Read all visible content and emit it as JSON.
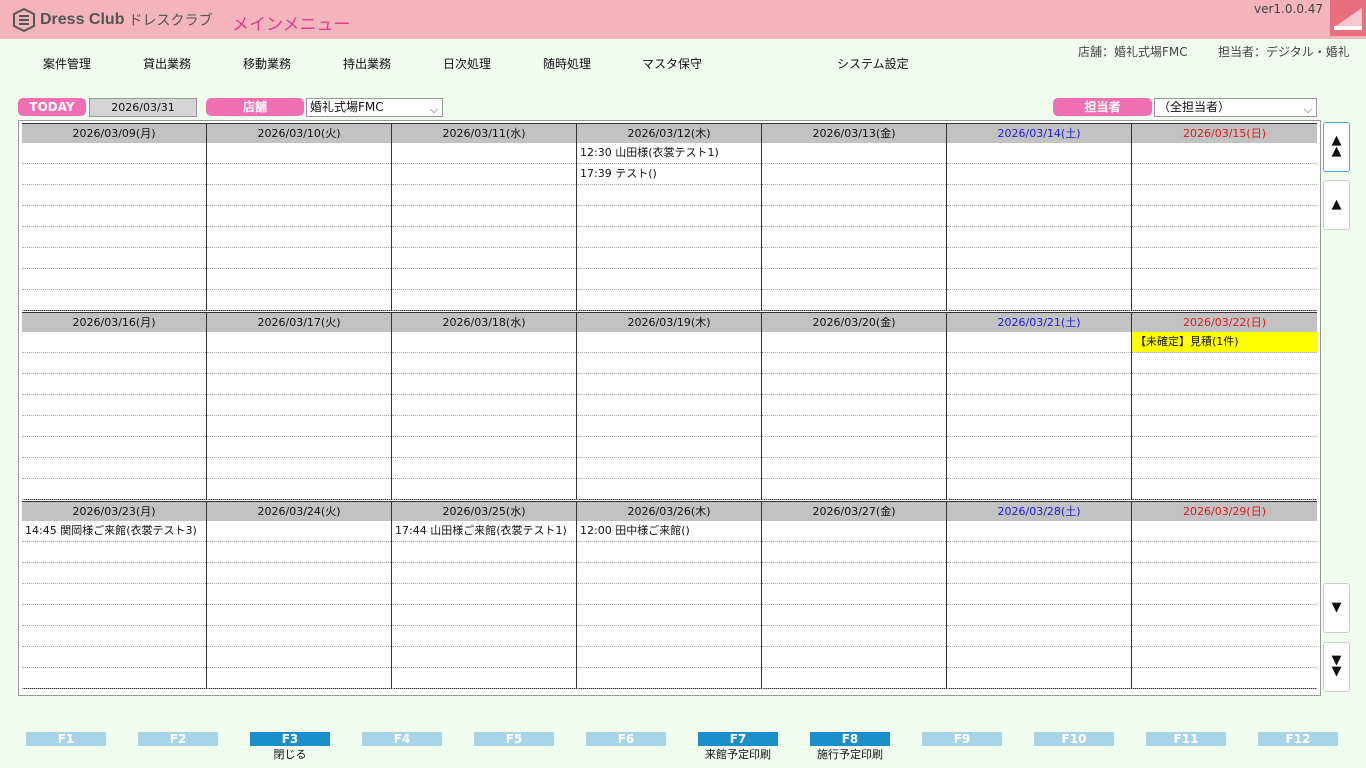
{
  "app": {
    "logo_text": "Dress Club",
    "logo_kana": "ドレスクラブ",
    "title": "メインメニュー",
    "version": "ver1.0.0.47"
  },
  "menu": [
    "案件管理",
    "貸出業務",
    "移動業務",
    "持出業務",
    "日次処理",
    "随時処理",
    "マスタ保守",
    "システム設定"
  ],
  "info": {
    "store": "店舗：婚礼式場FMC",
    "staff": "担当者：デジタル・婚礼"
  },
  "toolbar": {
    "today_label": "TODAY",
    "today_date": "2026/03/31",
    "store_label": "店舗",
    "store_value": "婚礼式場FMC",
    "staff_label": "担当者",
    "staff_value": "（全担当者）"
  },
  "weeks": [
    {
      "days": [
        {
          "date": "2026/03/09(月)",
          "type": "weekday",
          "events": []
        },
        {
          "date": "2026/03/10(火)",
          "type": "weekday",
          "events": []
        },
        {
          "date": "2026/03/11(水)",
          "type": "weekday",
          "events": []
        },
        {
          "date": "2026/03/12(木)",
          "type": "weekday",
          "events": [
            "12:30 山田様(衣裳テスト1)",
            "17:39 テスト()"
          ]
        },
        {
          "date": "2026/03/13(金)",
          "type": "weekday",
          "events": []
        },
        {
          "date": "2026/03/14(土)",
          "type": "sat",
          "events": []
        },
        {
          "date": "2026/03/15(日)",
          "type": "sun",
          "events": []
        }
      ]
    },
    {
      "days": [
        {
          "date": "2026/03/16(月)",
          "type": "weekday",
          "events": []
        },
        {
          "date": "2026/03/17(火)",
          "type": "weekday",
          "events": []
        },
        {
          "date": "2026/03/18(水)",
          "type": "weekday",
          "events": []
        },
        {
          "date": "2026/03/19(木)",
          "type": "weekday",
          "events": []
        },
        {
          "date": "2026/03/20(金)",
          "type": "weekday",
          "events": []
        },
        {
          "date": "2026/03/21(土)",
          "type": "sat",
          "events": []
        },
        {
          "date": "2026/03/22(日)",
          "type": "sun",
          "events": [
            "【未確定】見積(1件)"
          ],
          "highlight": true
        }
      ]
    },
    {
      "days": [
        {
          "date": "2026/03/23(月)",
          "type": "weekday",
          "events": [
            "14:45 関岡様ご来館(衣裳テスト3)"
          ]
        },
        {
          "date": "2026/03/24(火)",
          "type": "weekday",
          "events": []
        },
        {
          "date": "2026/03/25(水)",
          "type": "weekday",
          "events": [
            "17:44 山田様ご来館(衣裳テスト1)"
          ]
        },
        {
          "date": "2026/03/26(木)",
          "type": "weekday",
          "events": [
            "12:00 田中様ご来館()"
          ]
        },
        {
          "date": "2026/03/27(金)",
          "type": "weekday",
          "events": []
        },
        {
          "date": "2026/03/28(土)",
          "type": "sat",
          "events": []
        },
        {
          "date": "2026/03/29(日)",
          "type": "sun",
          "events": []
        }
      ]
    }
  ],
  "fkeys": [
    {
      "key": "F1",
      "label": "",
      "enabled": false
    },
    {
      "key": "F2",
      "label": "",
      "enabled": false
    },
    {
      "key": "F3",
      "label": "閉じる",
      "enabled": true
    },
    {
      "key": "F4",
      "label": "",
      "enabled": false
    },
    {
      "key": "F5",
      "label": "",
      "enabled": false
    },
    {
      "key": "F6",
      "label": "",
      "enabled": false
    },
    {
      "key": "F7",
      "label": "来館予定印刷",
      "enabled": true
    },
    {
      "key": "F8",
      "label": "施行予定印刷",
      "enabled": true
    },
    {
      "key": "F9",
      "label": "",
      "enabled": false
    },
    {
      "key": "F10",
      "label": "",
      "enabled": false
    },
    {
      "key": "F11",
      "label": "",
      "enabled": false
    },
    {
      "key": "F12",
      "label": "",
      "enabled": false
    }
  ],
  "colors": {
    "titlebar": "#f3b4bb",
    "accent_pink": "#f06fb2",
    "title_text": "#e23a8f",
    "saturday": "#1a1ae0",
    "sunday": "#e01a1a",
    "highlight": "#ffff00",
    "fkey_on": "#1a8fc9",
    "fkey_off": "#a8d4e8"
  }
}
